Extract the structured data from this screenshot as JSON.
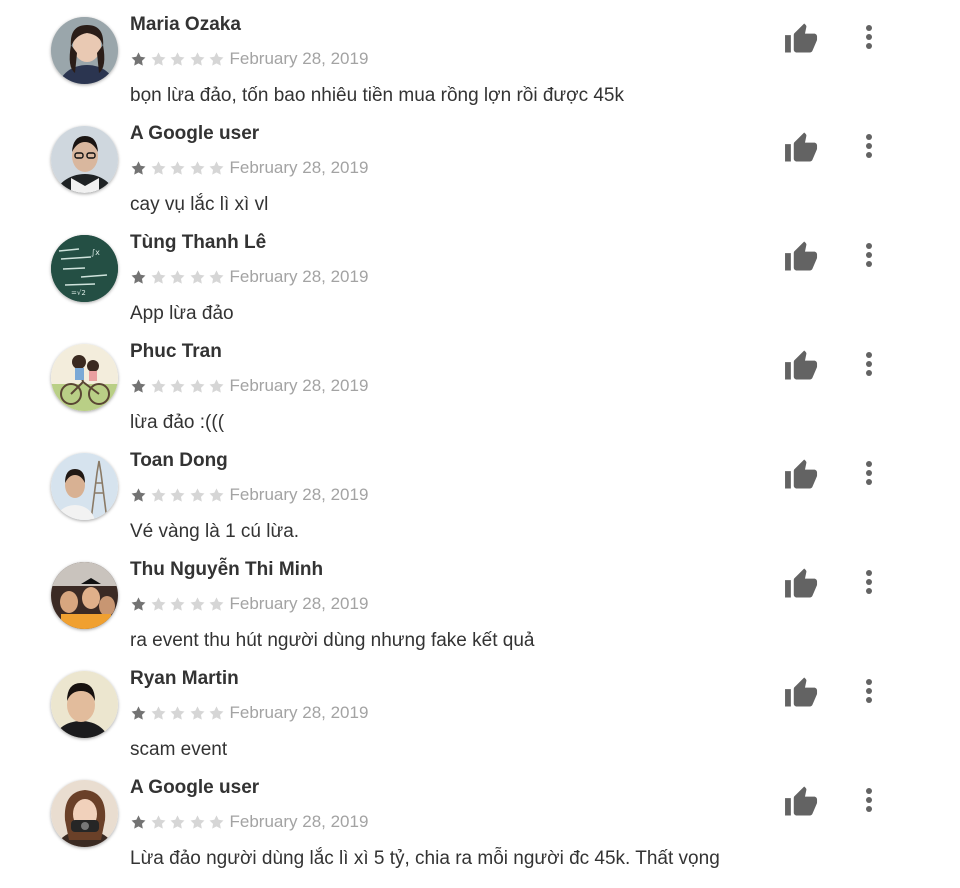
{
  "reviews": [
    {
      "author": "Maria Ozaka",
      "rating": 1,
      "date": "February 28, 2019",
      "text": "bọn lừa đảo, tốn bao nhiêu tiền mua rồng lợn rồi được 45k"
    },
    {
      "author": "A Google user",
      "rating": 1,
      "date": "February 28, 2019",
      "text": "cay vụ lắc lì xì vl"
    },
    {
      "author": "Tùng Thanh Lê",
      "rating": 1,
      "date": "February 28, 2019",
      "text": "App lừa đảo"
    },
    {
      "author": "Phuc Tran",
      "rating": 1,
      "date": "February 28, 2019",
      "text": "lừa đảo :((("
    },
    {
      "author": "Toan Dong",
      "rating": 1,
      "date": "February 28, 2019",
      "text": "Vé vàng là 1 cú lừa."
    },
    {
      "author": "Thu Nguyễn Thi Minh",
      "rating": 1,
      "date": "February 28, 2019",
      "text": "ra event thu hút người dùng nhưng fake kết quả"
    },
    {
      "author": "Ryan Martin",
      "rating": 1,
      "date": "February 28, 2019",
      "text": "scam event"
    },
    {
      "author": "A Google user",
      "rating": 1,
      "date": "February 28, 2019",
      "text": "Lừa đảo người dùng lắc lì xì 5 tỷ, chia ra mỗi người đc 45k. Thất vọng"
    }
  ],
  "icons": {
    "helpful": "thumbs-up-icon",
    "more": "more-vert-icon",
    "star": "star-icon"
  },
  "colors": {
    "star_filled": "#737373",
    "star_empty": "#d6d6d6",
    "action_icon": "#636363",
    "author_text": "#333333",
    "date_text": "#a3a3a3"
  }
}
